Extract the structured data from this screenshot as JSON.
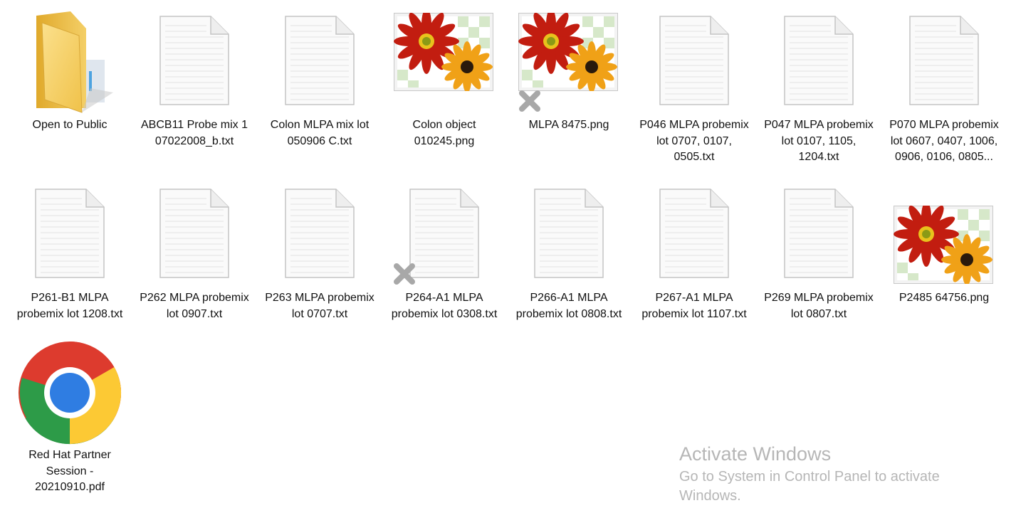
{
  "desktop": {
    "items": [
      {
        "name": "Open to Public",
        "type": "folder",
        "icon": "folder-icon"
      },
      {
        "name": "ABCB11 Probe mix 1 07022008_b.txt",
        "type": "txt",
        "icon": "text-document-icon"
      },
      {
        "name": "Colon MLPA mix lot 050906 C.txt",
        "type": "txt",
        "icon": "text-document-icon"
      },
      {
        "name": "Colon object 010245.png",
        "type": "png",
        "icon": "image-thumbnail-icon"
      },
      {
        "name": "MLPA 8475.png",
        "type": "png",
        "icon": "image-thumbnail-icon",
        "status": "x-overlay"
      },
      {
        "name": "P046 MLPA probemix lot 0707, 0107, 0505.txt",
        "type": "txt",
        "icon": "text-document-icon"
      },
      {
        "name": "P047 MLPA probemix lot 0107, 1105, 1204.txt",
        "type": "txt",
        "icon": "text-document-icon"
      },
      {
        "name": "P070 MLPA probemix lot 0607, 0407, 1006, 0906, 0106, 0805...",
        "type": "txt",
        "icon": "text-document-icon"
      },
      {
        "name": "P261-B1 MLPA probemix lot 1208.txt",
        "type": "txt",
        "icon": "text-document-icon"
      },
      {
        "name": "P262 MLPA probemix lot 0907.txt",
        "type": "txt",
        "icon": "text-document-icon"
      },
      {
        "name": "P263 MLPA probemix lot 0707.txt",
        "type": "txt",
        "icon": "text-document-icon"
      },
      {
        "name": "P264-A1 MLPA probemix lot 0308.txt",
        "type": "txt",
        "icon": "text-document-icon",
        "status": "x-overlay"
      },
      {
        "name": "P266-A1 MLPA probemix lot 0808.txt",
        "type": "txt",
        "icon": "text-document-icon"
      },
      {
        "name": "P267-A1 MLPA probemix lot 1107.txt",
        "type": "txt",
        "icon": "text-document-icon"
      },
      {
        "name": "P269 MLPA probemix lot 0807.txt",
        "type": "txt",
        "icon": "text-document-icon"
      },
      {
        "name": "P2485 64756.png",
        "type": "png",
        "icon": "image-thumbnail-icon"
      },
      {
        "name": "Red Hat Partner Session - 20210910.pdf",
        "type": "pdf",
        "icon": "chrome-icon"
      }
    ]
  },
  "watermark": {
    "title": "Activate Windows",
    "subtitle": "Go to System in Control Panel to activate Windows."
  },
  "colors": {
    "label_text": "#111111",
    "watermark_text": "#b6b6b6",
    "folder": "#f2c94c",
    "status_x": "#a8a8a8"
  }
}
